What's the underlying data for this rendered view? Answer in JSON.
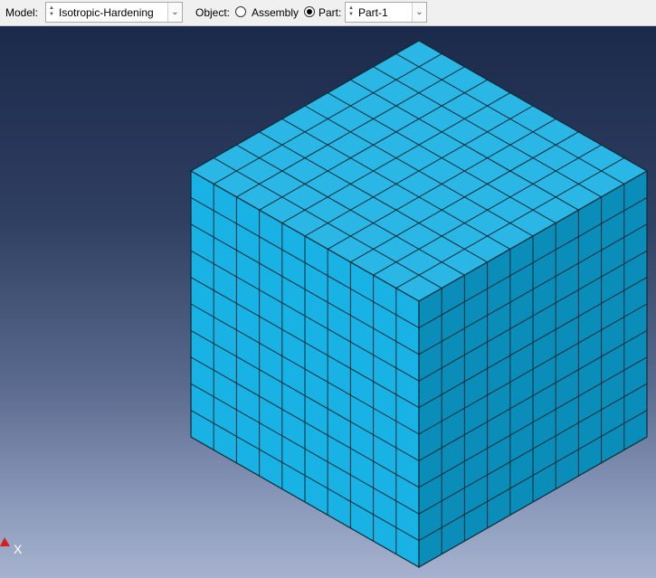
{
  "toolbar": {
    "model_label": "Model:",
    "model_value": "Isotropic-Hardening",
    "object_label": "Object:",
    "assembly_label": "Assembly",
    "part_label": "Part:",
    "part_value": "Part-1",
    "selected_object": "Part"
  },
  "viewport": {
    "mesh": {
      "divisions": 10,
      "colors": {
        "top": "#2ab7e6",
        "left": "#18b2e4",
        "right": "#0a8db8",
        "edges": "#0b2b36"
      }
    },
    "triad": {
      "x_label": "X",
      "colors": {
        "x_arrow": "#d62020"
      }
    }
  }
}
